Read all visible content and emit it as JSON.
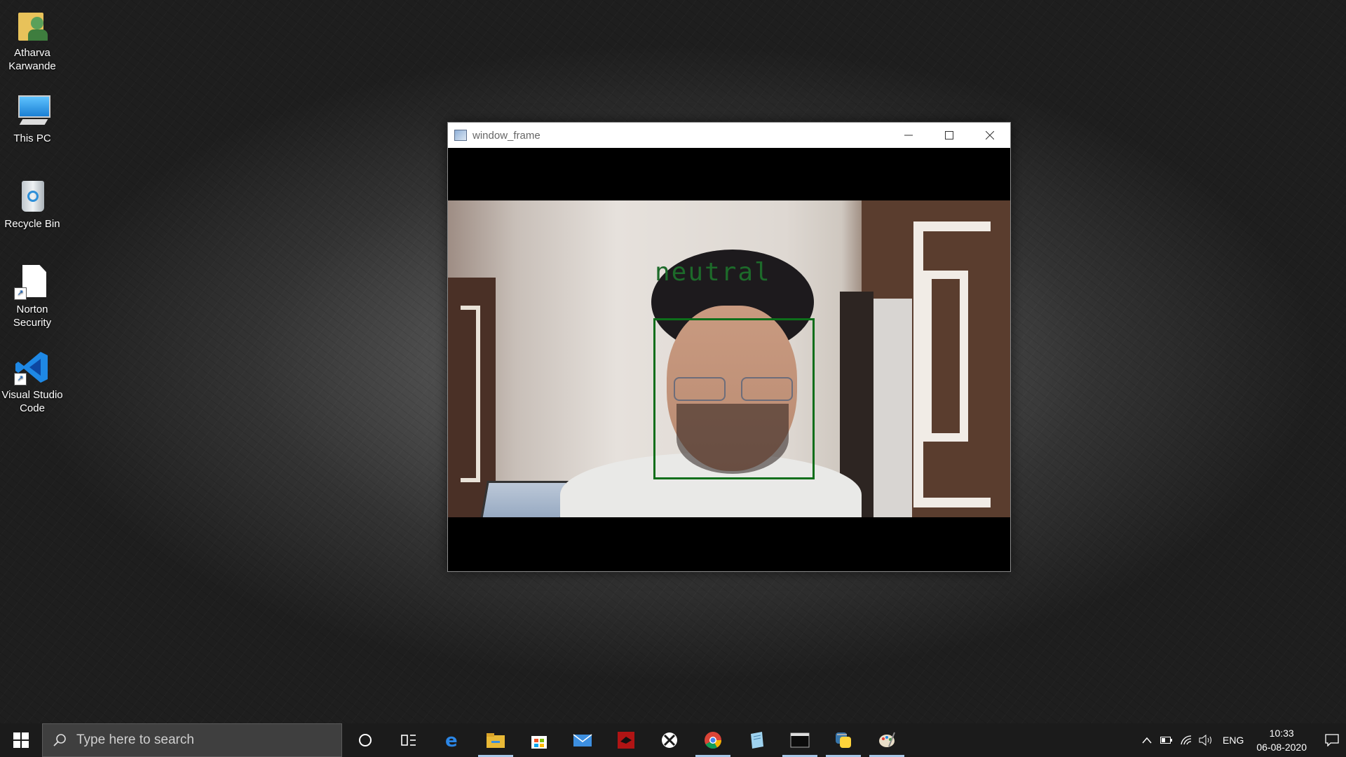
{
  "desktop": {
    "icons": [
      {
        "label": "Atharva Karwande",
        "icon": "user-folder-icon"
      },
      {
        "label": "This PC",
        "icon": "computer-icon"
      },
      {
        "label": "Recycle Bin",
        "icon": "recycle-bin-icon"
      },
      {
        "label": "Norton Security",
        "icon": "file-shortcut-icon"
      },
      {
        "label": "Visual Studio Code",
        "icon": "vscode-icon"
      }
    ]
  },
  "window": {
    "title": "window_frame",
    "detected_emotion": "neutral",
    "box_color": "#0d6e1a"
  },
  "taskbar": {
    "search_placeholder": "Type here to search",
    "pinned": [
      "cortana-icon",
      "task-view-icon",
      "edge-icon",
      "file-explorer-icon",
      "store-icon",
      "mail-icon",
      "red-app-icon",
      "xbox-icon",
      "chrome-icon",
      "notepad-icon",
      "terminal-icon",
      "python-icon",
      "paint-icon"
    ],
    "tray": {
      "language": "ENG",
      "time": "10:33",
      "date": "06-08-2020"
    }
  }
}
